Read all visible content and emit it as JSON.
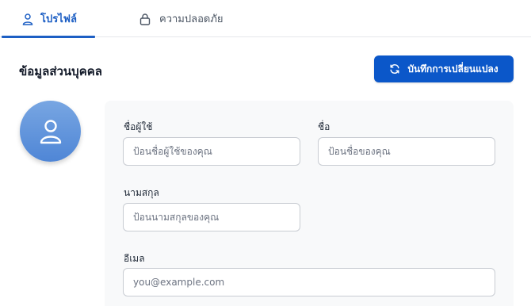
{
  "tabs": {
    "profile": {
      "label": "โปรไฟล์",
      "icon": "user-icon"
    },
    "security": {
      "label": "ความปลอดภัย",
      "icon": "lock-icon"
    }
  },
  "section": {
    "title": "ข้อมูลส่วนบุคคล"
  },
  "save_button": {
    "label": "บันทึกการเปลี่ยนแปลง",
    "icon": "refresh-icon"
  },
  "avatar": {
    "icon": "user-icon"
  },
  "form": {
    "username": {
      "label": "ชื่อผู้ใช้",
      "placeholder": "ป้อนชื่อผู้ใช้ของคุณ",
      "value": ""
    },
    "first_name": {
      "label": "ชื่อ",
      "placeholder": "ป้อนชื่อของคุณ",
      "value": ""
    },
    "last_name": {
      "label": "นามสกุล",
      "placeholder": "ป้อนนามสกุลของคุณ",
      "value": ""
    },
    "email": {
      "label": "อีเมล",
      "placeholder": "you@example.com",
      "value": ""
    }
  },
  "colors": {
    "accent": "#0b57c9",
    "tab_active": "#1d5fc4",
    "avatar": "#5b8fd9",
    "card_bg": "#f8f9fa"
  }
}
